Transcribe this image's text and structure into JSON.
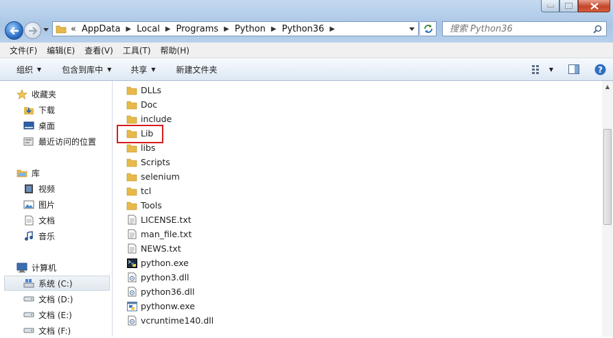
{
  "address": {
    "overflow": "«",
    "segments": [
      "AppData",
      "Local",
      "Programs",
      "Python",
      "Python36"
    ]
  },
  "search": {
    "placeholder": "搜索 Python36"
  },
  "menu": [
    "文件(F)",
    "编辑(E)",
    "查看(V)",
    "工具(T)",
    "帮助(H)"
  ],
  "toolbar": {
    "organize": "组织",
    "include_in_library": "包含到库中",
    "share": "共享",
    "new_folder": "新建文件夹"
  },
  "sidebar": {
    "favorites": {
      "label": "收藏夹",
      "items": [
        "下载",
        "桌面",
        "最近访问的位置"
      ]
    },
    "libraries": {
      "label": "库",
      "items": [
        "视频",
        "图片",
        "文档",
        "音乐"
      ]
    },
    "computer": {
      "label": "计算机",
      "items": [
        "系统 (C:)",
        "文档 (D:)",
        "文档 (E:)",
        "文档 (F:)"
      ]
    }
  },
  "files": [
    {
      "name": "DLLs",
      "type": "folder"
    },
    {
      "name": "Doc",
      "type": "folder"
    },
    {
      "name": "include",
      "type": "folder"
    },
    {
      "name": "Lib",
      "type": "folder"
    },
    {
      "name": "libs",
      "type": "folder"
    },
    {
      "name": "Scripts",
      "type": "folder"
    },
    {
      "name": "selenium",
      "type": "folder"
    },
    {
      "name": "tcl",
      "type": "folder"
    },
    {
      "name": "Tools",
      "type": "folder"
    },
    {
      "name": "LICENSE.txt",
      "type": "text"
    },
    {
      "name": "man_file.txt",
      "type": "text"
    },
    {
      "name": "NEWS.txt",
      "type": "text"
    },
    {
      "name": "python.exe",
      "type": "exe"
    },
    {
      "name": "python3.dll",
      "type": "dll"
    },
    {
      "name": "python36.dll",
      "type": "dll"
    },
    {
      "name": "pythonw.exe",
      "type": "exe"
    },
    {
      "name": "vcruntime140.dll",
      "type": "dll"
    }
  ],
  "colors": {
    "highlight": "#d81a1a",
    "folder": "#e8b94a"
  }
}
